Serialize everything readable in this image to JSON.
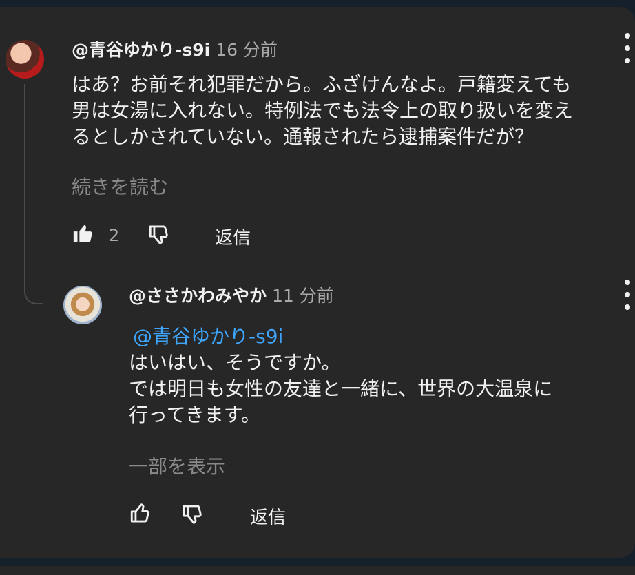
{
  "comment": {
    "author": "@青谷ゆかり-s9i",
    "time": "16 分前",
    "lines": [
      "はあ？お前それ犯罪だから。ふざけんなよ。戸籍変えても",
      "男は女湯に入れない。特例法でも法令上の取り扱いを変え",
      "るとしかされていない。通報されたら逮捕案件だが？"
    ],
    "read_more": "続きを読む",
    "like_count": "2",
    "reply_label": "返信",
    "icons": {
      "like": "thumb-up-filled-icon",
      "dislike": "thumb-down-outline-icon",
      "menu": "kebab-menu-icon"
    }
  },
  "reply": {
    "author": "@ささかわみやか",
    "time": "11 分前",
    "mention": "@青谷ゆかり-s9i",
    "lines": [
      "はいはい、そうですか。",
      "では明日も女性の友達と一緒に、世界の大温泉に",
      "行ってきます。"
    ],
    "read_more": "一部を表示",
    "reply_label": "返信",
    "icons": {
      "like": "thumb-up-outline-icon",
      "dislike": "thumb-down-outline-icon",
      "menu": "kebab-menu-icon"
    }
  },
  "colors": {
    "background": "#272727",
    "page_background": "#15202b",
    "text": "#f1f1f1",
    "secondary_text": "#aaaaaa",
    "muted_text": "#8a8a8a",
    "mention": "#3ea6ff"
  }
}
